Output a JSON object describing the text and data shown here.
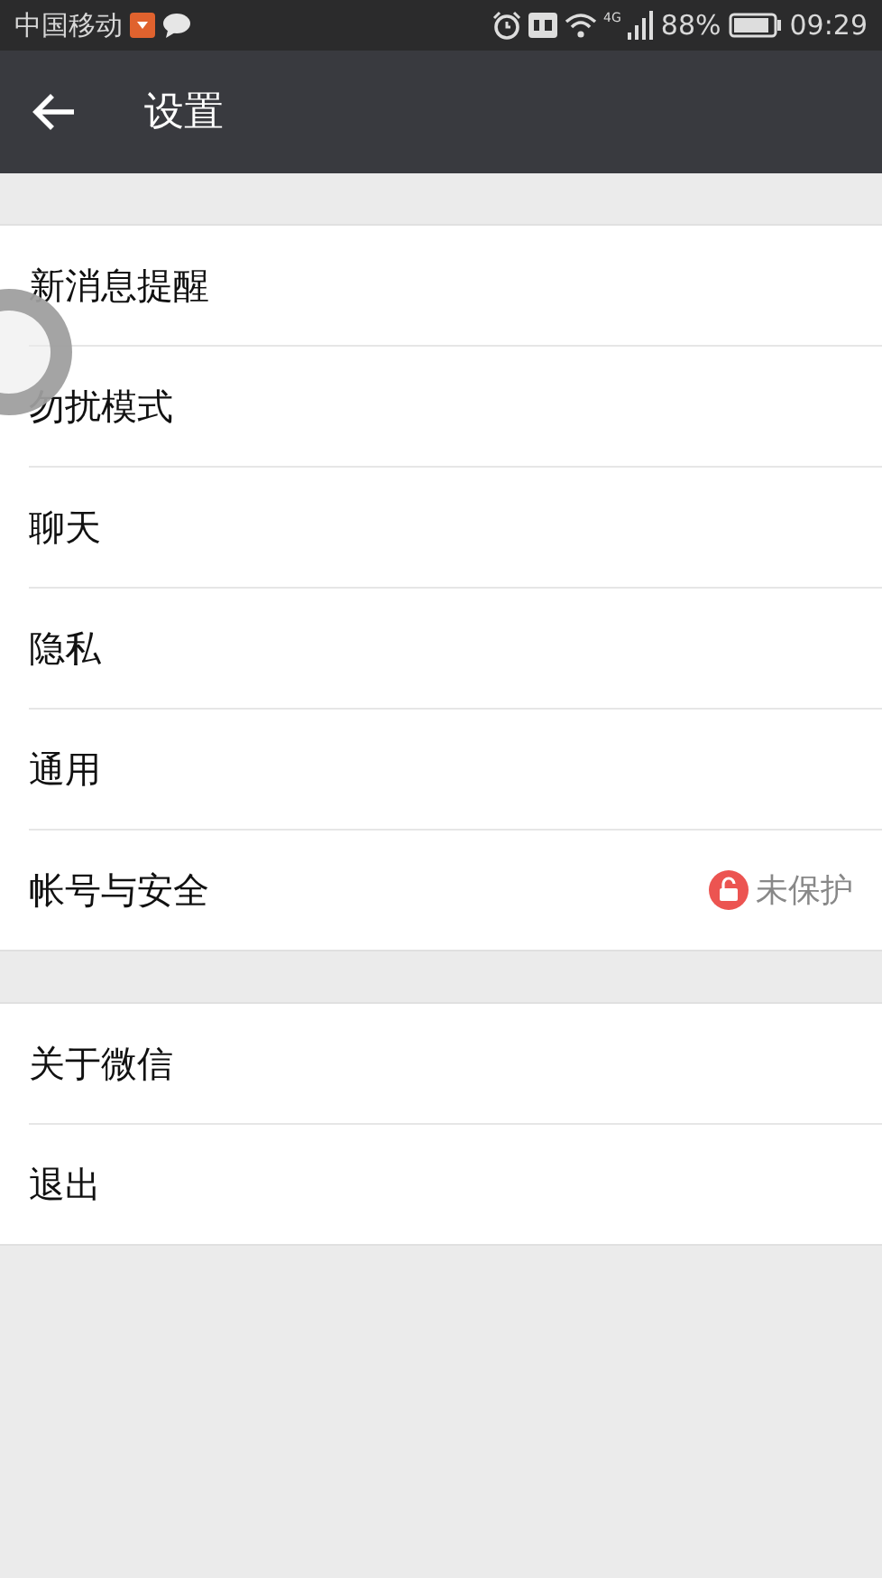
{
  "status_bar": {
    "carrier": "中国移动",
    "network": "4G",
    "battery": "88%",
    "time": "09:29"
  },
  "header": {
    "title": "设置"
  },
  "groups": [
    {
      "items": [
        {
          "label": "新消息提醒"
        },
        {
          "label": "勿扰模式"
        },
        {
          "label": "聊天"
        },
        {
          "label": "隐私"
        },
        {
          "label": "通用"
        },
        {
          "label": "帐号与安全",
          "status": "未保护"
        }
      ]
    },
    {
      "items": [
        {
          "label": "关于微信"
        },
        {
          "label": "退出"
        }
      ]
    }
  ]
}
